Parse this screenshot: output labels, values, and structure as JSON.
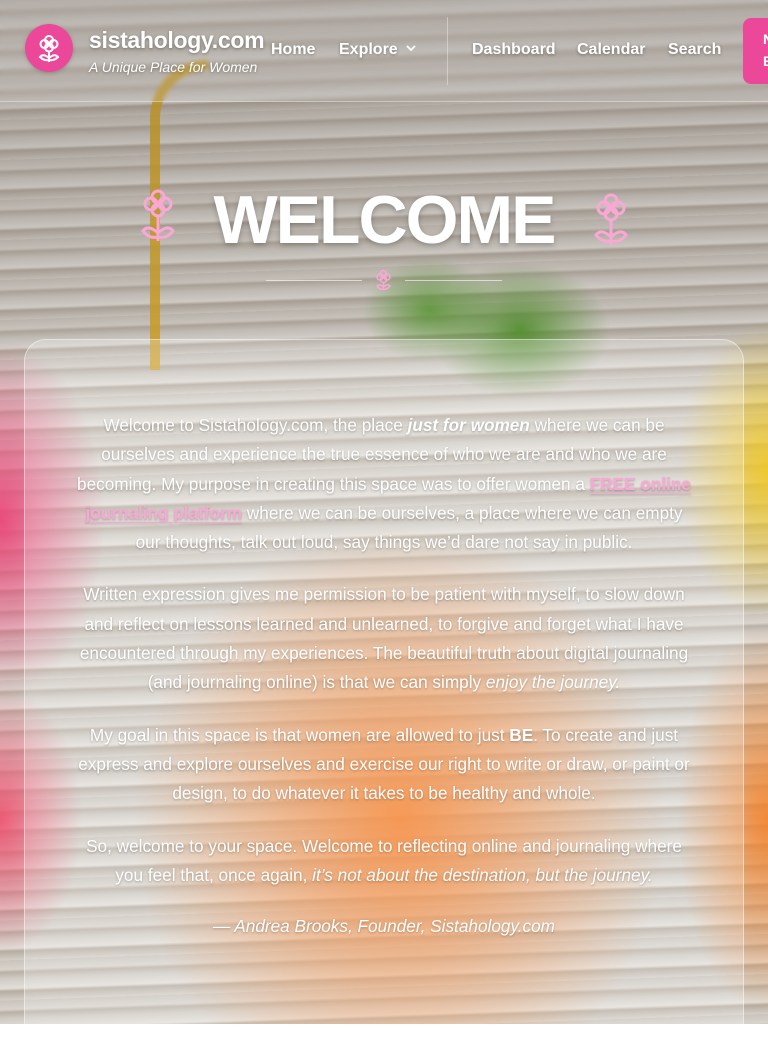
{
  "site": {
    "title": "sistahology.com",
    "tagline": "A Unique Place for Women",
    "brand_color": "#ec4899",
    "logo_icon": "flower-icon"
  },
  "nav": {
    "home": "Home",
    "explore": "Explore",
    "dashboard": "Dashboard",
    "calendar": "Calendar",
    "search": "Search",
    "cta_label": "N E"
  },
  "hero": {
    "title": "WELCOME",
    "icon": "flower-icon"
  },
  "content": {
    "p1_a": "Welcome to Sistahology.com, the place ",
    "p1_em": "just for women",
    "p1_b": " where we can be ourselves and experience the true essence of who we are and who we are becoming. My purpose in creating this space was to offer women a ",
    "p1_link": "FREE online journaling platform",
    "p1_c": " where we can be ourselves, a place where we can empty our thoughts, talk out loud, say things we’d dare not say in public.",
    "p2_a": "Written expression gives me permission to be patient with myself, to slow down and reflect on lessons learned and unlearned, to forgive and forget what I have encountered through my experiences. The beautiful truth about digital journaling (and journaling online) is that we can simply ",
    "p2_em": "enjoy the journey.",
    "p3_a": "My goal in this space is that women are allowed to just ",
    "p3_b": "BE",
    "p3_c": ". To create and just express and explore ourselves and exercise our right to write or draw, or paint or design, to do whatever it takes to be healthy and whole.",
    "p4_a": "So, welcome to your space. Welcome to reflecting online and journaling where you feel that, once again, ",
    "p4_em": "it’s not about the destination, but the journey.",
    "signature": "— Andrea Brooks, Founder, Sistahology.com"
  }
}
